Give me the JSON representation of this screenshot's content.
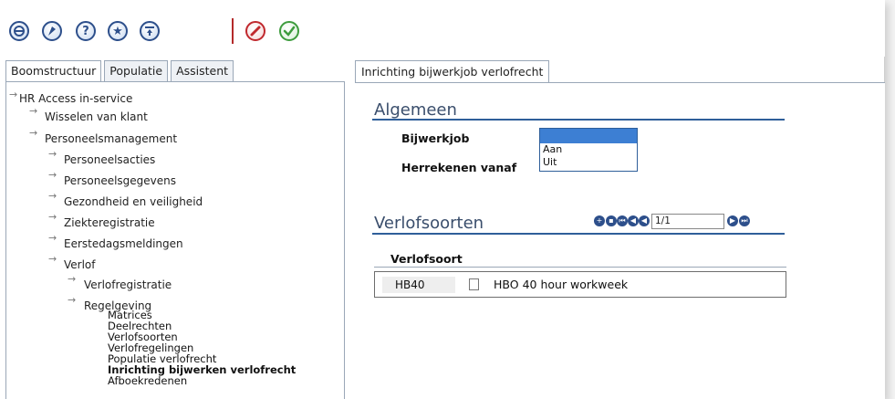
{
  "toolbar": {
    "icons": [
      "home-icon",
      "pin-icon",
      "help-icon",
      "favorite-icon",
      "menu-icon",
      "cancel-icon",
      "confirm-icon"
    ],
    "help_glyph": "?",
    "star_glyph": "★"
  },
  "left_tabs": [
    "Boomstructuur",
    "Populatie",
    "Assistent"
  ],
  "tree": {
    "root": "HR Access in-service",
    "items": {
      "wisselen": "Wisselen van klant",
      "personeelsmanagement": "Personeelsmanagement",
      "personeelsacties": "Personeelsacties",
      "personeelsgegevens": "Personeelsgegevens",
      "gezondheid": "Gezondheid en veiligheid",
      "ziekteregistratie": "Ziekteregistratie",
      "eerstedags": "Eerstedagsmeldingen",
      "verlof": "Verlof",
      "verlofregistratie": "Verlofregistratie",
      "regelgeving": "Regelgeving"
    },
    "leaves": {
      "matrices": "Matrices",
      "deelrechten": "Deelrechten",
      "verlofsoorten": "Verlofsoorten",
      "verlofregelingen": "Verlofregelingen",
      "populatie": "Populatie verlofrecht",
      "inrichting": "Inrichting bijwerken verlofrecht",
      "afboek": "Afboekredenen"
    }
  },
  "right_tab": "Inrichting bijwerkjob verlofrecht",
  "algemeen": {
    "title": "Algemeen",
    "bijwerkjob_label": "Bijwerkjob",
    "herrekenen_label": "Herrekenen vanaf",
    "options": [
      "",
      "Aan",
      "Uit"
    ]
  },
  "verlofsoorten": {
    "title": "Verlofsoorten",
    "page": "1/1",
    "column": "Verlofsoort",
    "rows": [
      {
        "code": "HB40",
        "description": "HBO 40 hour workweek"
      }
    ]
  }
}
